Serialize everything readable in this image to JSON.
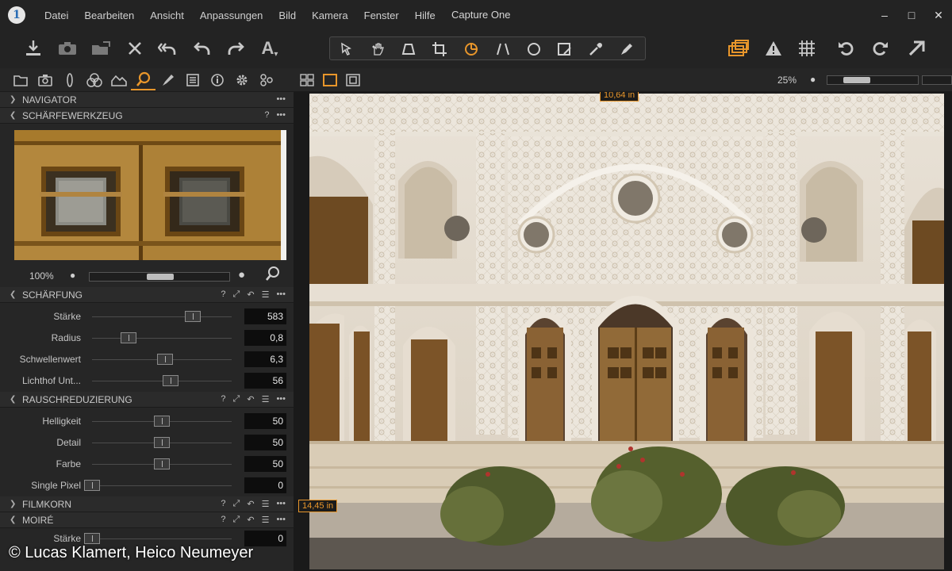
{
  "app": {
    "title": "Capture One",
    "logo_glyph": "1",
    "menu": [
      "Datei",
      "Bearbeiten",
      "Ansicht",
      "Anpassungen",
      "Bild",
      "Kamera",
      "Fenster",
      "Hilfe"
    ],
    "window_controls": {
      "minimize": "–",
      "maximize": "□",
      "close": "✕"
    }
  },
  "toolbar": {
    "left_icons": [
      "import-icon",
      "camera-icon",
      "export-icon",
      "delete-icon",
      "undo-all-icon",
      "undo-icon",
      "redo-icon",
      "text-tool-icon"
    ],
    "cursor_tools": [
      "select-cursor-icon",
      "pan-icon",
      "keystone-icon",
      "crop-icon",
      "rotate-icon",
      "straighten-icon",
      "circle-mask-icon",
      "erase-icon",
      "color-picker-icon",
      "brush-icon"
    ],
    "right_icons": [
      "stack-icon",
      "warning-icon",
      "grid-icon",
      "rotate-left-icon",
      "rotate-right-icon",
      "share-icon"
    ],
    "accent_color": "#e8962b"
  },
  "tool_tabs": [
    "library-icon",
    "camera-tab-icon",
    "lens-icon",
    "color-icon",
    "exposure-icon",
    "details-icon",
    "adjustments-icon",
    "metadata-icon",
    "info-icon",
    "settings-icon",
    "batch-icon"
  ],
  "navigator": {
    "title": "NAVIGATOR"
  },
  "sharpening_tool": {
    "title": "SCHÄRFEWERKZEUG",
    "help": "?",
    "zoom": "100%"
  },
  "sharpening": {
    "title": "SCHÄRFUNG",
    "rows": [
      {
        "label": "Stärke",
        "value": "583",
        "level": 0.72
      },
      {
        "label": "Radius",
        "value": "0,8",
        "level": 0.26
      },
      {
        "label": "Schwellenwert",
        "value": "6,3",
        "level": 0.52
      },
      {
        "label": "Lichthof Unt...",
        "value": "56",
        "level": 0.56
      }
    ]
  },
  "noise": {
    "title": "RAUSCHREDUZIERUNG",
    "rows": [
      {
        "label": "Helligkeit",
        "value": "50",
        "level": 0.5
      },
      {
        "label": "Detail",
        "value": "50",
        "level": 0.5
      },
      {
        "label": "Farbe",
        "value": "50",
        "level": 0.5
      },
      {
        "label": "Single Pixel",
        "value": "0",
        "level": 0.0
      }
    ]
  },
  "filmgrain": {
    "title": "FILMKORN"
  },
  "moire": {
    "title": "MOIRÉ",
    "first_label": "Stärke",
    "first_value": "0"
  },
  "viewer": {
    "zoom": "25%",
    "width_badge": "10,64 in",
    "height_badge": "14,45 in"
  },
  "credit": "© Lucas Klamert, Heico Neumeyer"
}
